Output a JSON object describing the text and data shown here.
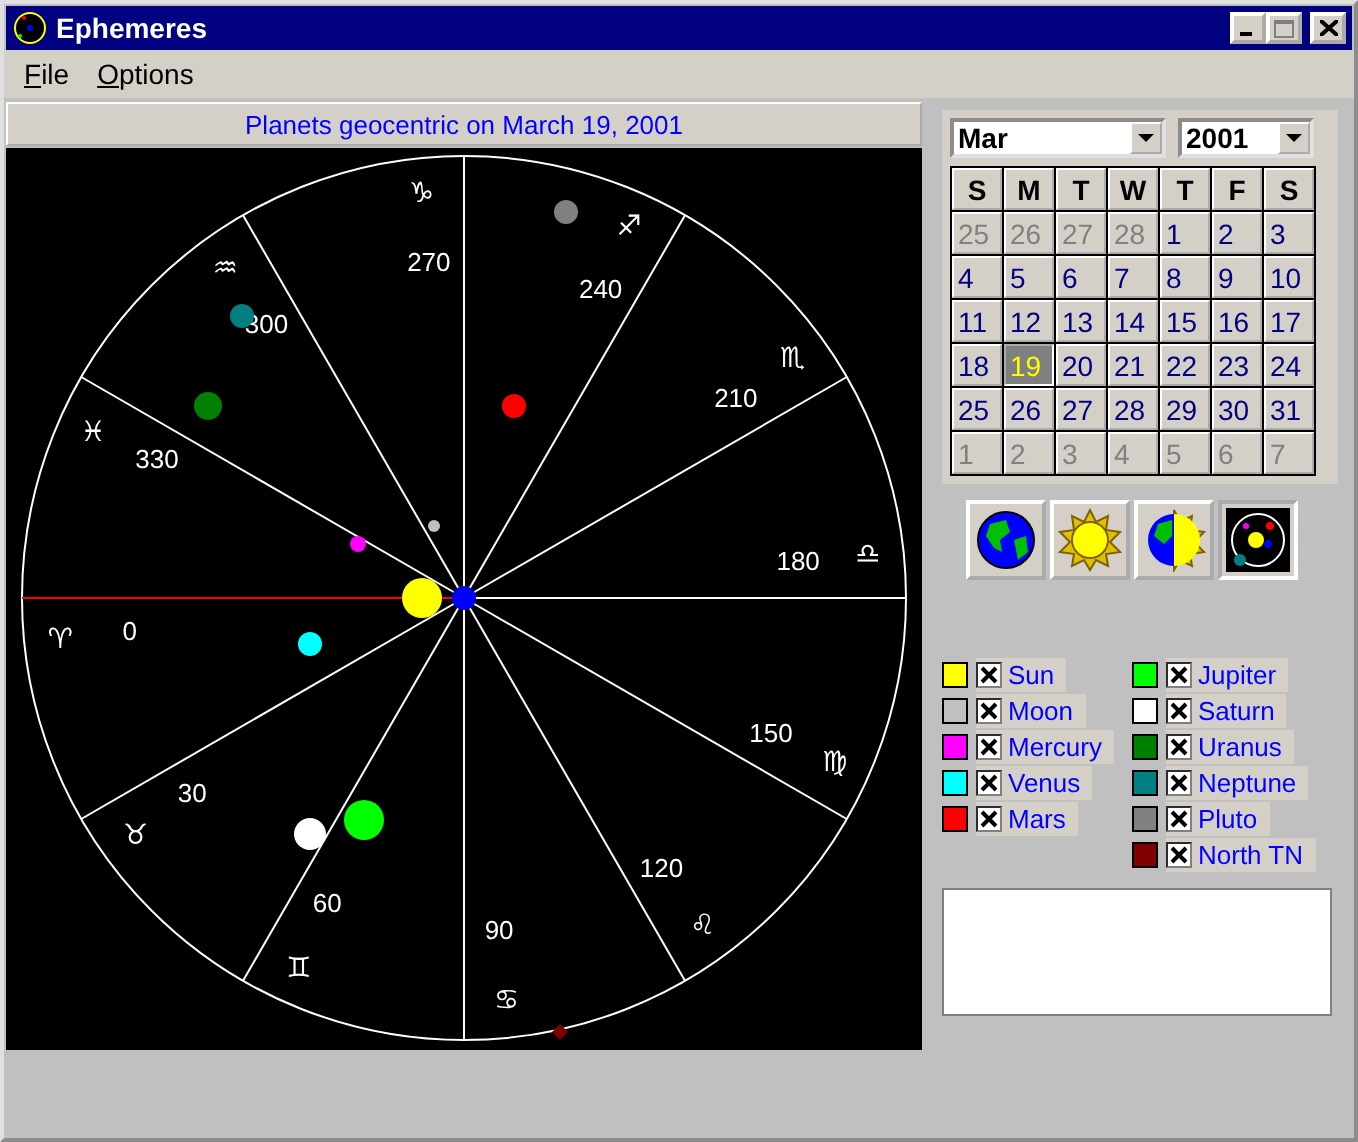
{
  "window": {
    "title": "Ephemeres"
  },
  "menu": [
    {
      "label": "File"
    },
    {
      "label": "Options"
    }
  ],
  "chart": {
    "title": "Planets geocentric on March 19, 2001",
    "degree_labels": [
      "0",
      "30",
      "60",
      "90",
      "120",
      "150",
      "180",
      "210",
      "240",
      "270",
      "300",
      "330"
    ],
    "sign_glyphs": [
      "♈",
      "♉",
      "♊",
      "♋",
      "♌",
      "♍",
      "♎",
      "♏",
      "♐",
      "♑",
      "♒",
      "♓"
    ]
  },
  "calendar": {
    "month": "Mar",
    "year": "2001",
    "weekdays": [
      "S",
      "M",
      "T",
      "W",
      "T",
      "F",
      "S"
    ],
    "days": [
      {
        "label": "25",
        "in_month": false,
        "selected": false
      },
      {
        "label": "26",
        "in_month": false,
        "selected": false
      },
      {
        "label": "27",
        "in_month": false,
        "selected": false
      },
      {
        "label": "28",
        "in_month": false,
        "selected": false
      },
      {
        "label": "1",
        "in_month": true,
        "selected": false
      },
      {
        "label": "2",
        "in_month": true,
        "selected": false
      },
      {
        "label": "3",
        "in_month": true,
        "selected": false
      },
      {
        "label": "4",
        "in_month": true,
        "selected": false
      },
      {
        "label": "5",
        "in_month": true,
        "selected": false
      },
      {
        "label": "6",
        "in_month": true,
        "selected": false
      },
      {
        "label": "7",
        "in_month": true,
        "selected": false
      },
      {
        "label": "8",
        "in_month": true,
        "selected": false
      },
      {
        "label": "9",
        "in_month": true,
        "selected": false
      },
      {
        "label": "10",
        "in_month": true,
        "selected": false
      },
      {
        "label": "11",
        "in_month": true,
        "selected": false
      },
      {
        "label": "12",
        "in_month": true,
        "selected": false
      },
      {
        "label": "13",
        "in_month": true,
        "selected": false
      },
      {
        "label": "14",
        "in_month": true,
        "selected": false
      },
      {
        "label": "15",
        "in_month": true,
        "selected": false
      },
      {
        "label": "16",
        "in_month": true,
        "selected": false
      },
      {
        "label": "17",
        "in_month": true,
        "selected": false
      },
      {
        "label": "18",
        "in_month": true,
        "selected": false
      },
      {
        "label": "19",
        "in_month": true,
        "selected": true
      },
      {
        "label": "20",
        "in_month": true,
        "selected": false
      },
      {
        "label": "21",
        "in_month": true,
        "selected": false
      },
      {
        "label": "22",
        "in_month": true,
        "selected": false
      },
      {
        "label": "23",
        "in_month": true,
        "selected": false
      },
      {
        "label": "24",
        "in_month": true,
        "selected": false
      },
      {
        "label": "25",
        "in_month": true,
        "selected": false
      },
      {
        "label": "26",
        "in_month": true,
        "selected": false
      },
      {
        "label": "27",
        "in_month": true,
        "selected": false
      },
      {
        "label": "28",
        "in_month": true,
        "selected": false
      },
      {
        "label": "29",
        "in_month": true,
        "selected": false
      },
      {
        "label": "30",
        "in_month": true,
        "selected": false
      },
      {
        "label": "31",
        "in_month": true,
        "selected": false
      },
      {
        "label": "1",
        "in_month": false,
        "selected": false
      },
      {
        "label": "2",
        "in_month": false,
        "selected": false
      },
      {
        "label": "3",
        "in_month": false,
        "selected": false
      },
      {
        "label": "4",
        "in_month": false,
        "selected": false
      },
      {
        "label": "5",
        "in_month": false,
        "selected": false
      },
      {
        "label": "6",
        "in_month": false,
        "selected": false
      },
      {
        "label": "7",
        "in_month": false,
        "selected": false
      }
    ]
  },
  "view_buttons": [
    {
      "kind": "earth",
      "selected": false
    },
    {
      "kind": "sun",
      "selected": false
    },
    {
      "kind": "earth-sun",
      "selected": false
    },
    {
      "kind": "solar-system",
      "selected": true
    }
  ],
  "legend": [
    {
      "label": "Sun",
      "color": "#ffff00",
      "checked": true
    },
    {
      "label": "Moon",
      "color": "#c0c0c0",
      "checked": true
    },
    {
      "label": "Mercury",
      "color": "#ff00ff",
      "checked": true
    },
    {
      "label": "Venus",
      "color": "#00ffff",
      "checked": true
    },
    {
      "label": "Mars",
      "color": "#ff0000",
      "checked": true
    },
    {
      "label": "Jupiter",
      "color": "#00ff00",
      "checked": true
    },
    {
      "label": "Saturn",
      "color": "#ffffff",
      "checked": true
    },
    {
      "label": "Uranus",
      "color": "#008000",
      "checked": true
    },
    {
      "label": "Neptune",
      "color": "#008080",
      "checked": true
    },
    {
      "label": "Pluto",
      "color": "#808080",
      "checked": true
    },
    {
      "label": "North TN",
      "color": "#800000",
      "checked": true
    }
  ]
}
